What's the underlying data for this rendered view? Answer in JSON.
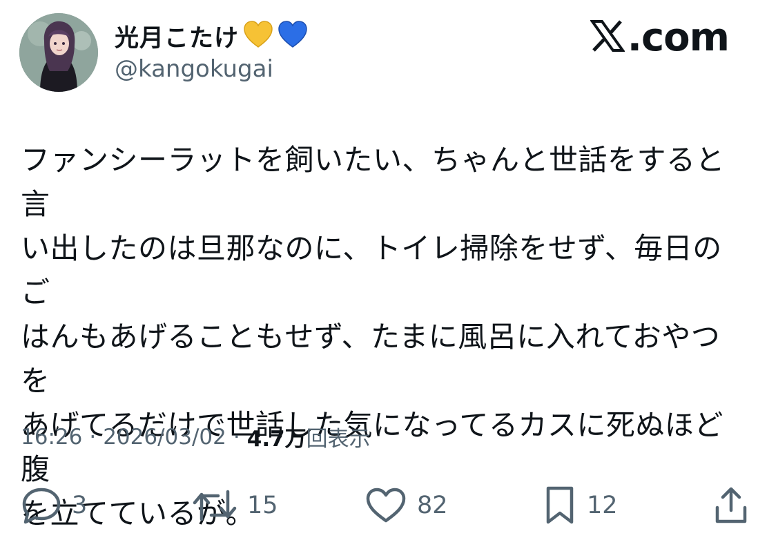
{
  "user": {
    "display_name": "光月こたけ",
    "handle": "@kangokugai",
    "hearts": [
      "yellow-heart-icon",
      "blue-heart-icon"
    ]
  },
  "brand": {
    "label": ".com",
    "logo_icon": "x-logo-icon"
  },
  "tweet": {
    "text": "ファンシーラットを飼いたい、ちゃんと世話をすると言\nい出したのは旦那なのに、トイレ掃除をせず、毎日のご\nはんもあげることもせず、たまに風呂に入れておやつを\nあげてるだけで世話した気になってるカスに死ぬほど腹\nを立てているが。"
  },
  "meta": {
    "time": "16:26",
    "separator": "·",
    "date": "2026/03/02",
    "views_count": "4.7万",
    "views_label": "回表示"
  },
  "actions": {
    "reply_count": "3",
    "retweet_count": "15",
    "like_count": "82",
    "bookmark_count": "12"
  },
  "colors": {
    "text": "#0f1419",
    "muted": "#536471",
    "yellow_heart": "#f6c235",
    "blue_heart": "#2b6ee6"
  }
}
